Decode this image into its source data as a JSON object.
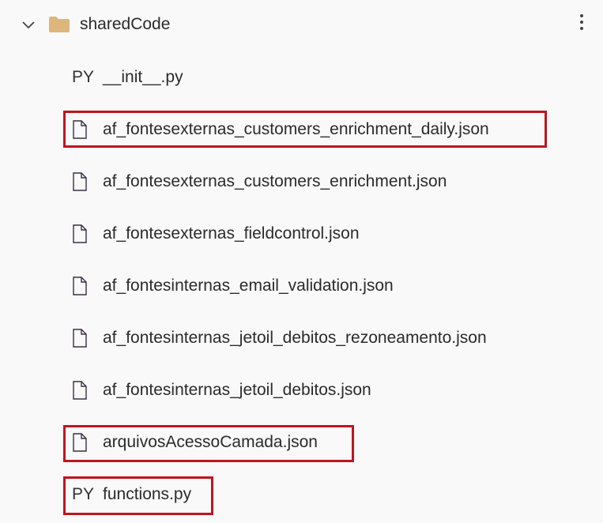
{
  "folder": {
    "name": "sharedCode",
    "expanded": true,
    "expand_icon": "chevron-down-icon",
    "icon": "folder-icon",
    "menu_icon": "more-vertical-icon"
  },
  "highlight_color": "#c0151f",
  "folder_color": "#dcb67a",
  "files": [
    {
      "name": "__init__.py",
      "type": "py",
      "badge": "PY",
      "highlighted": false
    },
    {
      "name": "af_fontesexternas_customers_enrichment_daily.json",
      "type": "json",
      "highlighted": true
    },
    {
      "name": "af_fontesexternas_customers_enrichment.json",
      "type": "json",
      "highlighted": false
    },
    {
      "name": "af_fontesexternas_fieldcontrol.json",
      "type": "json",
      "highlighted": false
    },
    {
      "name": "af_fontesinternas_email_validation.json",
      "type": "json",
      "highlighted": false
    },
    {
      "name": "af_fontesinternas_jetoil_debitos_rezoneamento.json",
      "type": "json",
      "highlighted": false
    },
    {
      "name": "af_fontesinternas_jetoil_debitos.json",
      "type": "json",
      "highlighted": false
    },
    {
      "name": "arquivosAcessoCamada.json",
      "type": "json",
      "highlighted": true
    },
    {
      "name": "functions.py",
      "type": "py",
      "badge": "PY",
      "highlighted": true
    }
  ]
}
